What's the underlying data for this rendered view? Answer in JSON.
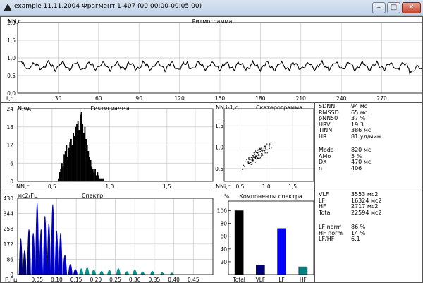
{
  "window": {
    "title": "example 11.11.2004 Фрагмент 1-407 (00:00:00-00:05:00)",
    "min_btn": "–",
    "max_btn": "□",
    "close_btn": "✕"
  },
  "rhythm": {
    "title": "Ритмограмма",
    "ylabel": "NN,c",
    "xlabel": "t,c",
    "yticks": [
      "0,0",
      "0,5",
      "1,0",
      "1,5",
      "2,0"
    ],
    "xticks": [
      "30",
      "60",
      "90",
      "120",
      "150",
      "180",
      "210",
      "240",
      "270"
    ],
    "chart_data": {
      "type": "line",
      "x_range": [
        0,
        300
      ],
      "y_range": [
        0,
        2.0
      ],
      "mean": 0.77,
      "min": 0.55,
      "max": 0.95
    }
  },
  "hist": {
    "title": "Гистограмма",
    "ylabel": "N,ед",
    "xlabel": "NN,c",
    "yticks": [
      "0",
      "6",
      "12",
      "18",
      "24"
    ],
    "xticks": [
      "0,5",
      "1,0",
      "1,5"
    ],
    "chart_data": {
      "type": "bar",
      "x_range": [
        0.2,
        1.9
      ],
      "y_range": [
        0,
        24
      ],
      "x": [
        0.55,
        0.56,
        0.57,
        0.58,
        0.59,
        0.6,
        0.61,
        0.62,
        0.63,
        0.64,
        0.65,
        0.66,
        0.67,
        0.68,
        0.69,
        0.7,
        0.71,
        0.72,
        0.73,
        0.74,
        0.75,
        0.76,
        0.77,
        0.78,
        0.79,
        0.8,
        0.81,
        0.82,
        0.83,
        0.84,
        0.85,
        0.86,
        0.87,
        0.88,
        0.89,
        0.9,
        0.91,
        0.92,
        0.93,
        0.94
      ],
      "values": [
        1,
        3,
        4,
        6,
        5,
        9,
        10,
        12,
        8,
        11,
        13,
        14,
        12,
        16,
        15,
        18,
        19,
        20,
        17,
        22,
        23,
        19,
        16,
        18,
        14,
        12,
        10,
        8,
        7,
        5,
        4,
        3,
        4,
        2,
        3,
        2,
        1,
        1,
        1,
        1
      ]
    }
  },
  "scatter": {
    "title": "Скатерограмма",
    "ylabel": "NN i-1,c",
    "xlabel": "NNi,c",
    "yticks": [
      "0,5",
      "1,0",
      "1,5"
    ],
    "xticks": [
      "0,5",
      "1,0",
      "1,5"
    ],
    "chart_data": {
      "type": "scatter",
      "x_range": [
        0.2,
        1.9
      ],
      "y_range": [
        0.2,
        1.9
      ],
      "center": [
        0.81,
        0.81
      ]
    }
  },
  "stats1": [
    {
      "k": "SDNN",
      "v": "94 мс"
    },
    {
      "k": "RMSSD",
      "v": "65 мс"
    },
    {
      "k": "pNN50",
      "v": "37 %"
    },
    {
      "k": "HRV",
      "v": "19.3"
    },
    {
      "k": "TINN",
      "v": "386 мс"
    },
    {
      "k": "HR",
      "v": "81 уд/мин"
    },
    {
      "k": "Moda",
      "v": "820 мс"
    },
    {
      "k": "AMo",
      "v": "5 %"
    },
    {
      "k": "DX",
      "v": "470 мс"
    },
    {
      "k": "n",
      "v": "406"
    }
  ],
  "spectrum": {
    "title": "Спектр",
    "ylabel": "мс2/Гц",
    "xlabel": "F,Гц",
    "yticks": [
      "0",
      "86",
      "172",
      "258",
      "344",
      "430"
    ],
    "xticks": [
      "0,05",
      "0,10",
      "0,15",
      "0,20",
      "0,25",
      "0,30",
      "0,35",
      "0,40",
      "0,45"
    ],
    "chart_data": {
      "type": "area",
      "x_range": [
        0,
        0.5
      ],
      "y_range": [
        0,
        430
      ],
      "peaks": [
        {
          "f": 0.008,
          "p": 205,
          "band": "VLF"
        },
        {
          "f": 0.018,
          "p": 140,
          "band": "VLF"
        },
        {
          "f": 0.029,
          "p": 255,
          "band": "VLF"
        },
        {
          "f": 0.04,
          "p": 235,
          "band": "LF"
        },
        {
          "f": 0.05,
          "p": 405,
          "band": "LF"
        },
        {
          "f": 0.06,
          "p": 255,
          "band": "LF"
        },
        {
          "f": 0.07,
          "p": 330,
          "band": "LF"
        },
        {
          "f": 0.08,
          "p": 290,
          "band": "LF"
        },
        {
          "f": 0.09,
          "p": 395,
          "band": "LF"
        },
        {
          "f": 0.1,
          "p": 245,
          "band": "LF"
        },
        {
          "f": 0.11,
          "p": 235,
          "band": "LF"
        },
        {
          "f": 0.121,
          "p": 110,
          "band": "LF"
        },
        {
          "f": 0.135,
          "p": 60,
          "band": "LF"
        },
        {
          "f": 0.148,
          "p": 30,
          "band": "LF"
        },
        {
          "f": 0.163,
          "p": 34,
          "band": "HF"
        },
        {
          "f": 0.178,
          "p": 40,
          "band": "HF"
        },
        {
          "f": 0.195,
          "p": 28,
          "band": "HF"
        },
        {
          "f": 0.215,
          "p": 20,
          "band": "HF"
        },
        {
          "f": 0.235,
          "p": 25,
          "band": "HF"
        },
        {
          "f": 0.258,
          "p": 35,
          "band": "HF"
        },
        {
          "f": 0.28,
          "p": 18,
          "band": "HF"
        },
        {
          "f": 0.3,
          "p": 28,
          "band": "HF"
        },
        {
          "f": 0.32,
          "p": 16,
          "band": "HF"
        },
        {
          "f": 0.345,
          "p": 20,
          "band": "HF"
        },
        {
          "f": 0.37,
          "p": 12,
          "band": "HF"
        },
        {
          "f": 0.395,
          "p": 10,
          "band": "HF"
        }
      ],
      "colors": {
        "VLF": "#000080",
        "LF": "#0000cc",
        "HF": "#009090"
      }
    }
  },
  "components": {
    "title": "Компоненты спектра",
    "ylabel": "%",
    "yticks": [
      "20",
      "40",
      "60",
      "80",
      "100"
    ],
    "chart_data": {
      "type": "bar",
      "y_range": [
        0,
        115
      ],
      "categories": [
        "Total",
        "VLF",
        "LF",
        "HF"
      ],
      "values": [
        100,
        15,
        72,
        12
      ],
      "colors": [
        "#000000",
        "#00007a",
        "#0000ff",
        "#008080"
      ]
    }
  },
  "stats2": [
    {
      "k": "VLF",
      "v": "3553 мс2"
    },
    {
      "k": "LF",
      "v": "16324 мс2"
    },
    {
      "k": "HF",
      "v": "2717 мс2"
    },
    {
      "k": "Total",
      "v": "22594 мс2"
    },
    {
      "k": "LF norm",
      "v": "86 %"
    },
    {
      "k": "HF norm",
      "v": "14 %"
    },
    {
      "k": "LF/HF",
      "v": "6.1"
    }
  ]
}
